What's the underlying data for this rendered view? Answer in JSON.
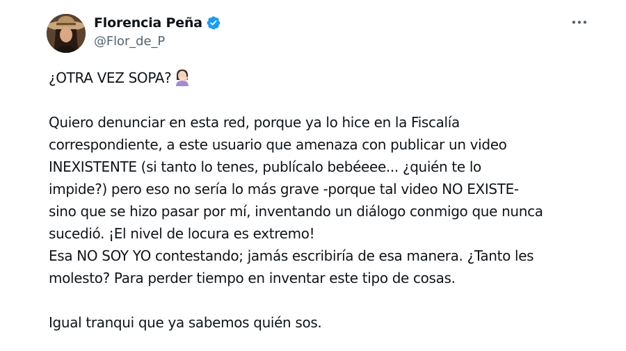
{
  "author": {
    "display_name": "Florencia Peña",
    "handle": "@Flor_de_P",
    "verified": true,
    "verified_color": "#1d9bf0"
  },
  "menu": {
    "icon": "more-horizontal-icon"
  },
  "tweet": {
    "first_line": "¿OTRA VEZ SOPA?",
    "first_line_emoji": "woman-facepalming-emoji",
    "lines": [
      "Quiero denunciar en esta red, porque ya lo hice en la Fiscalía",
      "correspondiente, a este usuario que amenaza con publicar un video",
      "INEXISTENTE (si tanto lo tenes, publícalo bebéeee... ¿quién te lo",
      "impide?) pero eso no sería lo más grave -porque tal video NO EXISTE-",
      "sino que se hizo pasar por mí, inventando un diálogo conmigo que nunca",
      "sucedió. ¡El nivel de locura es extremo!",
      "Esa NO SOY YO contestando; jamás escribiría de esa manera. ¿Tanto les",
      "molesto? Para perder tiempo en inventar este tipo de cosas."
    ],
    "last_line": "Igual tranqui que ya sabemos quién sos."
  }
}
